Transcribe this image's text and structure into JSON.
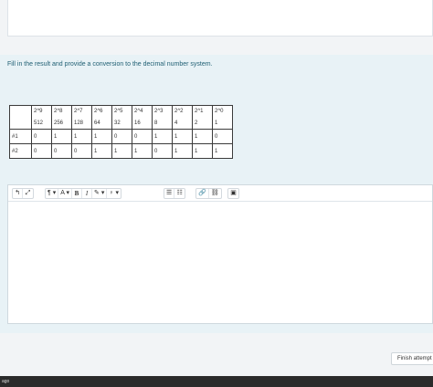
{
  "question": {
    "prompt": "Fill in the result and provide a conversion to the decimal number system.",
    "powers": [
      "2^9",
      "2^8",
      "2^7",
      "2^6",
      "2^5",
      "2^4",
      "2^3",
      "2^2",
      "2^1",
      "2^0"
    ],
    "weights": [
      "512",
      "256",
      "128",
      "64",
      "32",
      "16",
      "8",
      "4",
      "2",
      "1"
    ],
    "rows": [
      {
        "label": "#1",
        "bits": [
          "0",
          "1",
          "1",
          "1",
          "0",
          "0",
          "1",
          "1",
          "1",
          "0"
        ]
      },
      {
        "label": "#2",
        "bits": [
          "0",
          "0",
          "0",
          "1",
          "1",
          "1",
          "0",
          "1",
          "1",
          "1"
        ]
      }
    ]
  },
  "toolbar": {
    "undo": "↰",
    "fullscreen": "⤢",
    "paragraph": "¶",
    "font": "A",
    "bold": "B",
    "italic": "I",
    "pen": "✎",
    "style": "♀",
    "bullets": "☰",
    "numbers": "☷",
    "link": "🔗",
    "unlink": "⛓",
    "image": "▣"
  },
  "footer": {
    "finish_label": "Finish attempt",
    "corner_text": "ago"
  }
}
